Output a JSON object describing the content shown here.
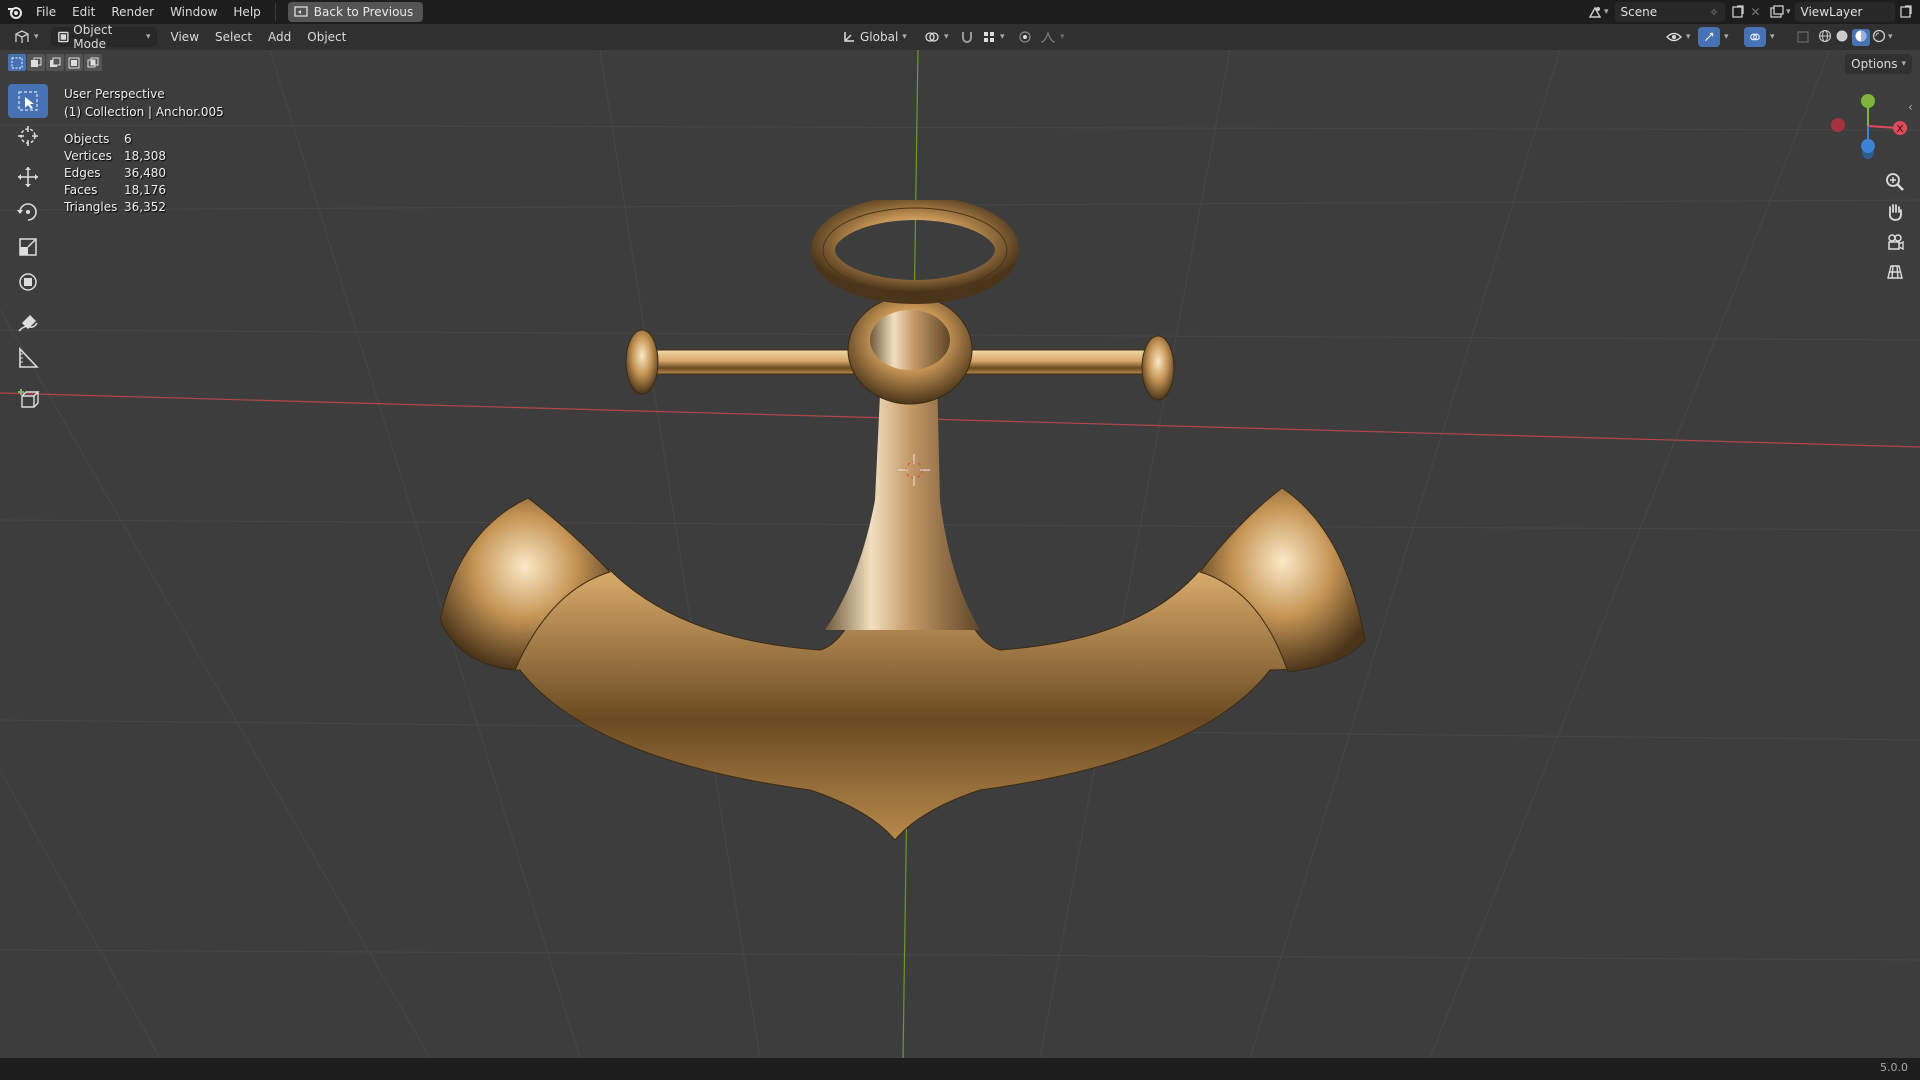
{
  "menubar": {
    "items": [
      "File",
      "Edit",
      "Render",
      "Window",
      "Help"
    ],
    "back_button": "Back to Previous",
    "scene_name": "Scene",
    "view_layer": "ViewLayer"
  },
  "header": {
    "mode": "Object Mode",
    "menus": [
      "View",
      "Select",
      "Add",
      "Object"
    ],
    "transform_orientation": "Global"
  },
  "viewport": {
    "perspective": "User Perspective",
    "collection_info": "(1) Collection | Anchor.005",
    "options_label": "Options",
    "stats": [
      {
        "label": "Objects",
        "value": "6"
      },
      {
        "label": "Vertices",
        "value": "18,308"
      },
      {
        "label": "Edges",
        "value": "36,480"
      },
      {
        "label": "Faces",
        "value": "18,176"
      },
      {
        "label": "Triangles",
        "value": "36,352"
      }
    ],
    "gizmo": {
      "x_label": "X",
      "x_color": "#e24a5c",
      "y_color": "#7fb43c",
      "z_color": "#3c82d6"
    }
  },
  "statusbar": {
    "version": "5.0.0"
  },
  "colors": {
    "accent": "#4772b3",
    "gold": "#c9a46a"
  }
}
